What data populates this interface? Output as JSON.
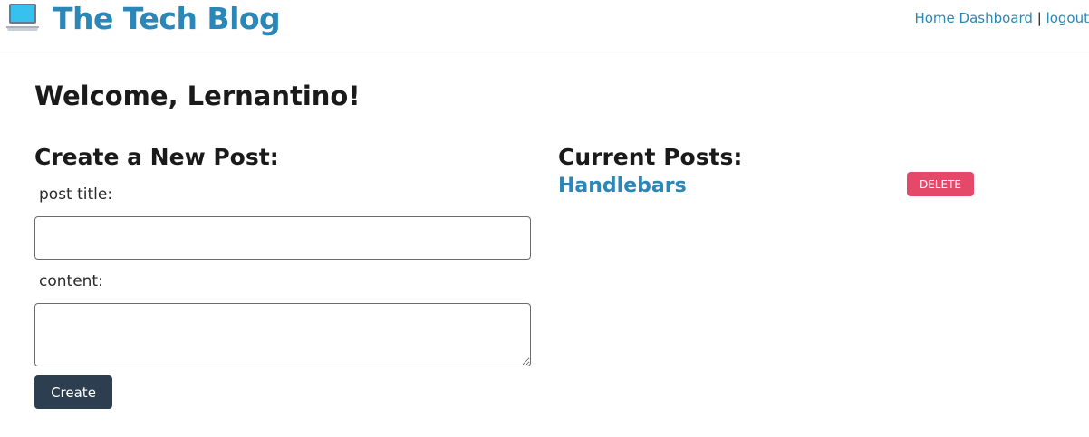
{
  "header": {
    "icon": "laptop-icon",
    "site_title": "The Tech Blog",
    "nav": {
      "home_label": "Home",
      "dashboard_label": "Dashboard",
      "separator": "|",
      "logout_label": "logout"
    }
  },
  "main": {
    "welcome": "Welcome, Lernantino!",
    "create_post": {
      "heading": "Create a New Post:",
      "title_label": "post title:",
      "title_value": "",
      "content_label": "content:",
      "content_value": "",
      "create_label": "Create"
    },
    "current_posts": {
      "heading": "Current Posts:",
      "posts": [
        {
          "title": "Handlebars",
          "delete_label": "DELETE"
        }
      ]
    }
  },
  "colors": {
    "brand": "#2a87b8",
    "create_button": "#2c3e50",
    "delete_button": "#e4496a"
  }
}
